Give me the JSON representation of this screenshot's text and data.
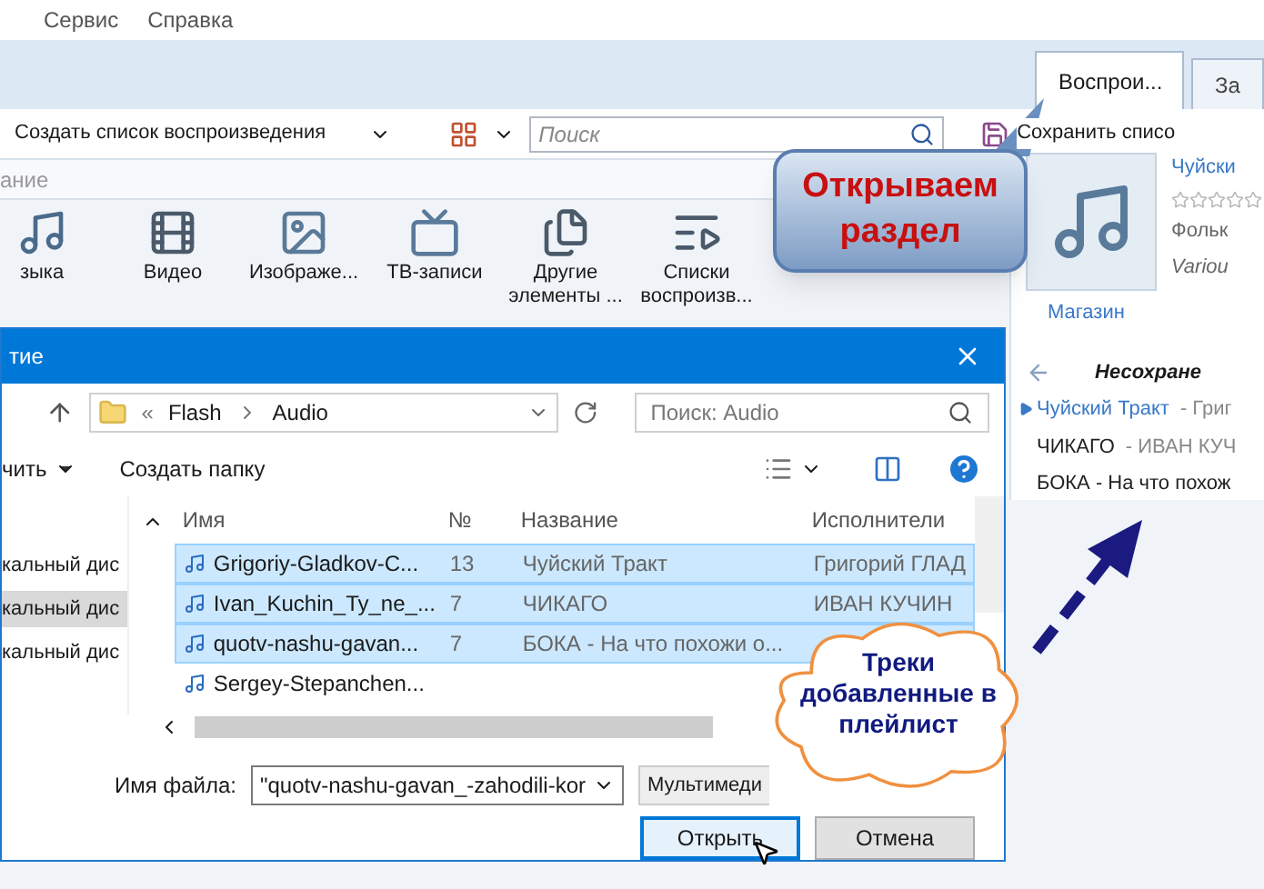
{
  "menu": [
    "Сервис",
    "Справка"
  ],
  "tabs": [
    {
      "label": "Воспрои...",
      "selected": true
    },
    {
      "label": "За",
      "selected": false
    }
  ],
  "toolbar": {
    "create_playlist": "Создать список воспроизведения",
    "search": {
      "placeholder": "Поиск"
    },
    "save_list": "Сохранить списо"
  },
  "breadcrumb": "ание",
  "categories": [
    {
      "label": "зыка",
      "kind": "music"
    },
    {
      "label": "Видео",
      "kind": "video"
    },
    {
      "label": "Изображе...",
      "kind": "image"
    },
    {
      "label": "ТВ-записи",
      "kind": "tv"
    },
    {
      "label": "Другие элементы ...",
      "kind": "other"
    },
    {
      "label": "Списки воспроизв...",
      "kind": "playlist"
    }
  ],
  "now_playing": {
    "title": "Чуйски",
    "stars": 0,
    "genre": "Фольк",
    "artist": "Variou",
    "store": "Магазин"
  },
  "playlist": {
    "title": "Несохране",
    "items": [
      {
        "title": "Чуйский Тракт",
        "artist": "- Григ",
        "playing": true
      },
      {
        "title": "ЧИКАГО",
        "artist": "- ИВАН КУЧ",
        "playing": false
      },
      {
        "title": "БОКА - На что похож",
        "playing": false
      }
    ]
  },
  "dialog": {
    "title": "тие",
    "path_prefix": "«",
    "path": [
      "Flash",
      "Audio"
    ],
    "search": {
      "placeholder": "Поиск: Audio"
    },
    "organize": "чить",
    "new_folder": "Создать папку",
    "nav": [
      {
        "label": "кальный дис",
        "selected": false
      },
      {
        "label": "кальный дис",
        "selected": true
      },
      {
        "label": "кальный дис",
        "selected": false
      }
    ],
    "columns": [
      "Имя",
      "№",
      "Название",
      "Исполнители"
    ],
    "rows": [
      {
        "name": "Grigoriy-Gladkov-C...",
        "number": "13",
        "title": "Чуйский Тракт",
        "artist": "Григорий ГЛАД",
        "selected": true
      },
      {
        "name": "Ivan_Kuchin_Ty_ne_...",
        "number": "7",
        "title": "ЧИКАГО",
        "artist": "ИВАН КУЧИН",
        "selected": true
      },
      {
        "name": "quotv-nashu-gavan...",
        "number": "7",
        "title": "БОКА - На что похожи о...",
        "selected": true
      },
      {
        "name": "Sergey-Stepanchen...",
        "selected": false
      }
    ],
    "filename_label": "Имя файла:",
    "filename": "\"quotv-nashu-gavan_-zahodili-kor",
    "file_type": "Мультимеди",
    "buttons": [
      {
        "label": "Открыть",
        "default": true
      },
      {
        "label": "Отмена",
        "default": false
      }
    ]
  },
  "callouts": {
    "section": "Открываем раздел",
    "tracks": "Треки добавленные в плейлист"
  }
}
